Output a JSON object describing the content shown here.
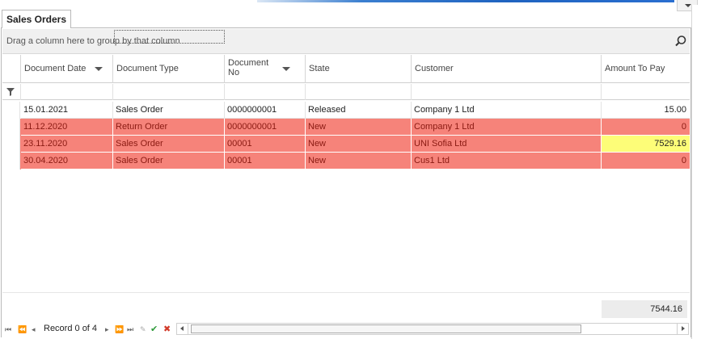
{
  "tab": {
    "label": "Sales Orders"
  },
  "group_panel": {
    "text": "Drag a column here to group by that column"
  },
  "icons": {
    "search": "search-icon",
    "filter": "filter-icon"
  },
  "colors": {
    "row_highlight": "#f6837a",
    "cell_highlight": "#fdfd78"
  },
  "columns": [
    {
      "label": "Document Date",
      "sorted": true
    },
    {
      "label": "Document Type",
      "sorted": false
    },
    {
      "label": "Document No",
      "sorted": true
    },
    {
      "label": "State",
      "sorted": false
    },
    {
      "label": "Customer",
      "sorted": false
    },
    {
      "label": "Amount To Pay",
      "sorted": false
    }
  ],
  "rows": [
    {
      "date": "15.01.2021",
      "type": "Sales Order",
      "no": "0000000001",
      "state": "Released",
      "customer": "Company 1 Ltd",
      "amount": "15.00",
      "highlight": false
    },
    {
      "date": "11.12.2020",
      "type": "Return Order",
      "no": "0000000001",
      "state": "New",
      "customer": "Company 1 Ltd",
      "amount": "0",
      "highlight": true
    },
    {
      "date": "23.11.2020",
      "type": "Sales Order",
      "no": "00001",
      "state": "New",
      "customer": "UNI Sofia Ltd",
      "amount": "7529.16",
      "highlight": true,
      "amount_yellow": true
    },
    {
      "date": "30.04.2020",
      "type": "Sales Order",
      "no": "00001",
      "state": "New",
      "customer": "Cus1 Ltd",
      "amount": "0",
      "highlight": true
    }
  ],
  "footer": {
    "total": "7544.16"
  },
  "navigator": {
    "record_text": "Record 0 of 4",
    "buttons": [
      "first",
      "prev-page",
      "prev",
      "next",
      "next-page",
      "last",
      "edit",
      "save",
      "cancel"
    ]
  }
}
